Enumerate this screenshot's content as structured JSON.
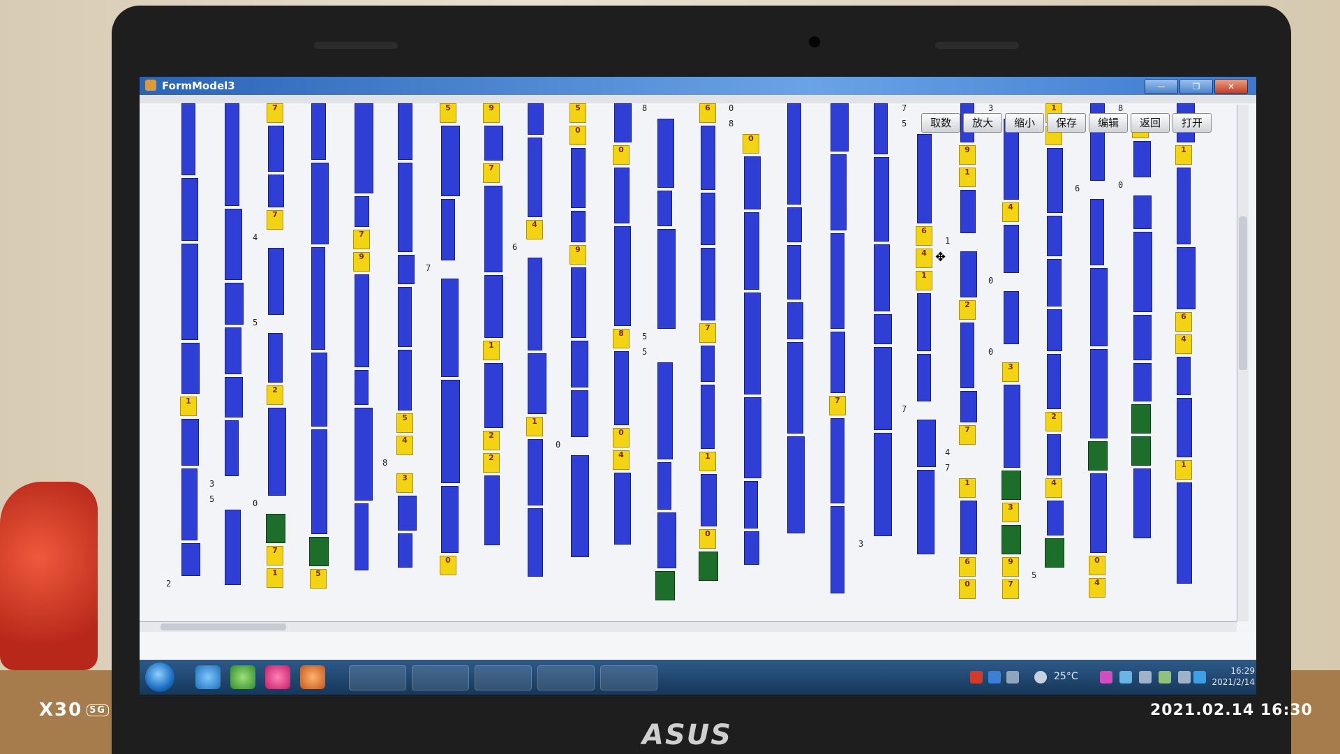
{
  "window": {
    "title": "FormModel3",
    "minimize_label": "—",
    "restore_label": "❐",
    "close_label": "✕"
  },
  "toolbar": {
    "buttons": [
      "取数",
      "放大",
      "缩小",
      "保存",
      "编辑",
      "返回",
      "打开"
    ]
  },
  "taskbar": {
    "temperature": "25°C",
    "clock_time": "16:29",
    "clock_date": "2021/2/14"
  },
  "camera_overlay": {
    "model": "X30",
    "network": "5G",
    "timestamp": "2021.02.14 16:30"
  },
  "laptop_brand": "ASUS",
  "colors": {
    "column_blue": "#2f3fd6",
    "cell_yellow": "#f2d414",
    "cell_green": "#1d6e2a",
    "titlebar": "#2b64b5",
    "taskbar": "#163759"
  }
}
